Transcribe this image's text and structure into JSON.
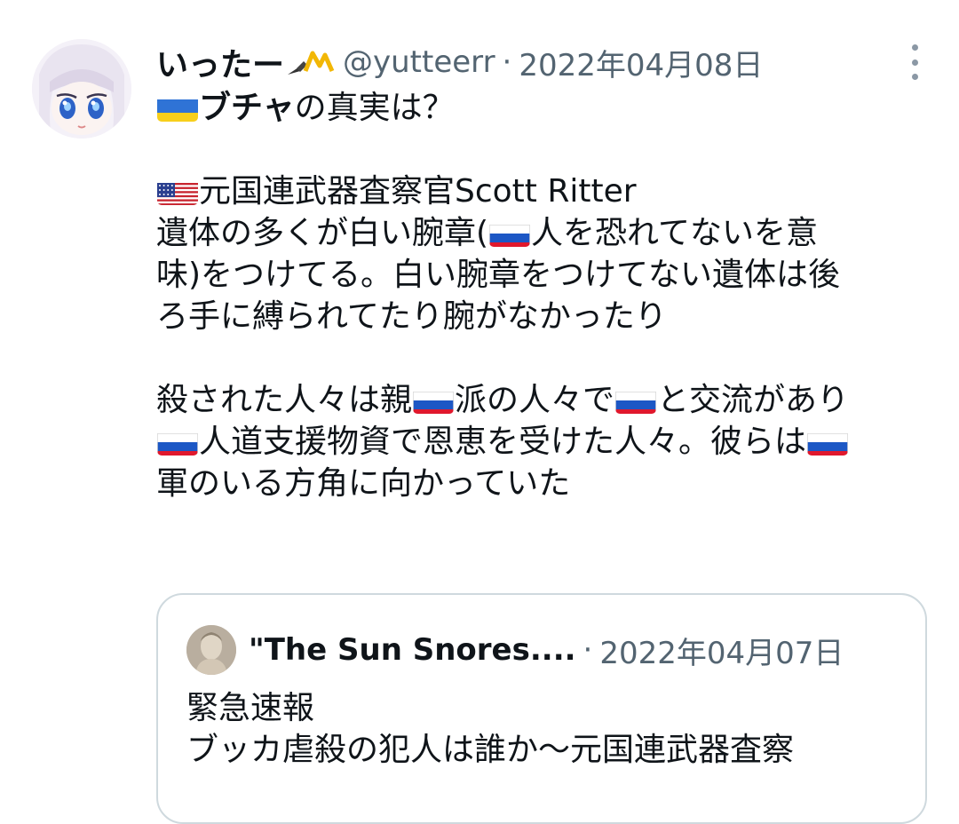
{
  "tweet": {
    "display_name": "いったー",
    "name_emoji": "crown-pencil-emoji",
    "handle": "@yutteerr",
    "separator": "·",
    "date": "2022年04月08日",
    "lines": [
      {
        "segments": [
          {
            "type": "flag",
            "flag": "ukraine-flag"
          },
          {
            "type": "text",
            "bold": true,
            "text": "ブチャ"
          },
          {
            "type": "text",
            "text": "の真実は？"
          }
        ]
      },
      {
        "segments": []
      },
      {
        "segments": [
          {
            "type": "flag",
            "flag": "us-flag"
          },
          {
            "type": "text",
            "text": "元国連武器査察官Scott Ritter"
          }
        ]
      },
      {
        "segments": [
          {
            "type": "text",
            "text": "遺体の多くが白い腕章("
          },
          {
            "type": "flag",
            "flag": "russia-flag"
          },
          {
            "type": "text",
            "text": "人を恐れてないを意"
          }
        ]
      },
      {
        "segments": [
          {
            "type": "text",
            "text": "味)をつけてる。白い腕章をつけてない遺体は後"
          }
        ]
      },
      {
        "segments": [
          {
            "type": "text",
            "text": "ろ手に縛られてたり腕がなかったり"
          }
        ]
      },
      {
        "segments": []
      },
      {
        "segments": [
          {
            "type": "text",
            "text": "殺された人々は親"
          },
          {
            "type": "flag",
            "flag": "russia-flag"
          },
          {
            "type": "text",
            "text": "派の人々で"
          },
          {
            "type": "flag",
            "flag": "russia-flag"
          },
          {
            "type": "text",
            "text": "と交流があり"
          }
        ]
      },
      {
        "segments": [
          {
            "type": "flag",
            "flag": "russia-flag"
          },
          {
            "type": "text",
            "text": "人道支援物資で恩恵を受けた人々。彼らは"
          },
          {
            "type": "flag",
            "flag": "russia-flag"
          }
        ]
      },
      {
        "segments": [
          {
            "type": "text",
            "text": "軍のいる方角に向かっていた"
          }
        ]
      }
    ]
  },
  "quote": {
    "name": "\"The Sun Snores....",
    "separator": "·",
    "date": "2022年04月07日",
    "lines": [
      "緊急速報",
      "ブッカ虐殺の犯人は誰か～元国連武器査察"
    ]
  },
  "colors": {
    "text": "#0f1419",
    "secondary": "#536471",
    "border": "#cfd9de"
  }
}
